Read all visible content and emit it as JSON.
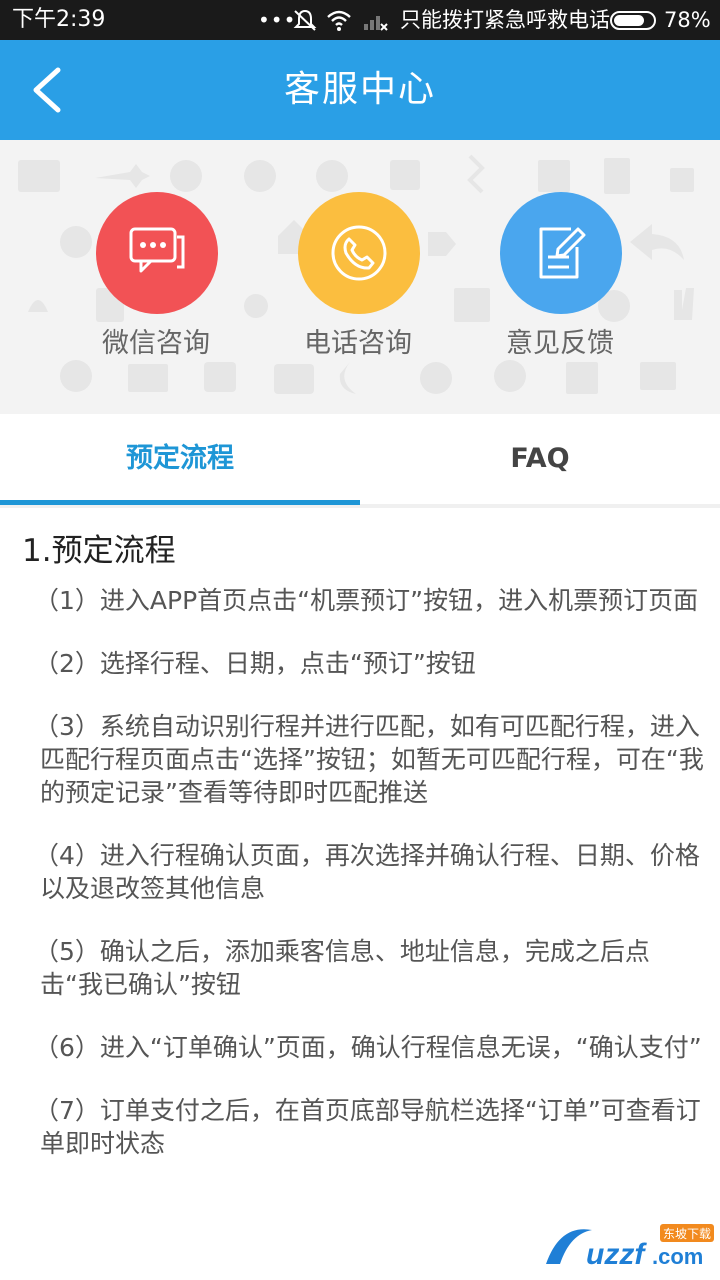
{
  "status_bar": {
    "time": "下午2:39",
    "dots": "•••",
    "carrier": "只能拨打紧急呼救电话",
    "battery_percent": 78,
    "battery_label": "78%"
  },
  "app_bar": {
    "title": "客服中心"
  },
  "actions": [
    {
      "label": "微信咨询",
      "color": "#f25255",
      "icon": "chat-bubble-icon"
    },
    {
      "label": "电话咨询",
      "color": "#fbbe3f",
      "icon": "phone-icon"
    },
    {
      "label": "意见反馈",
      "color": "#4aa6ee",
      "icon": "feedback-edit-icon"
    }
  ],
  "tabs": [
    {
      "label": "预定流程",
      "active": true
    },
    {
      "label": "FAQ",
      "active": false
    }
  ],
  "content": {
    "section_title": "1.预定流程",
    "steps": [
      "（1）进入APP首页点击“机票预订”按钮，进入机票预订页面",
      "（2）选择行程、日期，点击“预订”按钮",
      "（3）系统自动识别行程并进行匹配，如有可匹配行程，进入匹配行程页面点击“选择”按钮；如暂无可匹配行程，可在“我的预定记录”查看等待即时匹配推送",
      "（4）进入行程确认页面，再次选择并确认行程、日期、价格以及退改签其他信息",
      "（5）确认之后，添加乘客信息、地址信息，完成之后点击“我已确认”按钮",
      "（6）进入“订单确认”页面，确认行程信息无误，“确认支付”",
      "（7）订单支付之后，在首页底部导航栏选择“订单”可查看订单即时状态"
    ]
  },
  "watermark": {
    "text": "uzzf.com",
    "badge": "东坡下载"
  },
  "colors": {
    "app_bar": "#2a9fe6",
    "tab_active": "#1e96d6"
  }
}
